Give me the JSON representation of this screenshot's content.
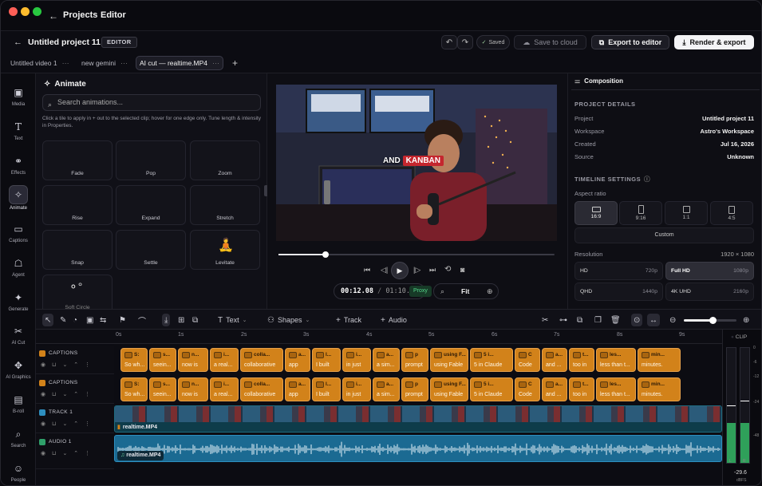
{
  "titlebar": {
    "projects": "Projects",
    "editor": "Editor"
  },
  "header": {
    "project_title": "Untitled project 11",
    "badge": "EDITOR",
    "saved": "Saved",
    "save_cloud": "Save to cloud",
    "export_editor": "Export to editor",
    "render_export": "Render & export"
  },
  "tabs": [
    {
      "label": "Untitled video 1"
    },
    {
      "label": "new gemini"
    },
    {
      "label": "AI cut — realtime.MP4"
    }
  ],
  "rail": [
    {
      "label": "Media",
      "icon": "media-icon"
    },
    {
      "label": "Text",
      "icon": "text-icon"
    },
    {
      "label": "Effects",
      "icon": "effects-icon"
    },
    {
      "label": "Animate",
      "icon": "animate-icon"
    },
    {
      "label": "Captions",
      "icon": "captions-icon"
    },
    {
      "label": "Agent",
      "icon": "agent-icon"
    },
    {
      "label": "Generate",
      "icon": "generate-icon"
    },
    {
      "label": "AI Cut",
      "icon": "scissors-icon"
    },
    {
      "label": "AI Graphics",
      "icon": "ai-graphics-icon"
    },
    {
      "label": "B-roll",
      "icon": "broll-icon"
    },
    {
      "label": "Search",
      "icon": "search-icon"
    },
    {
      "label": "People",
      "icon": "people-icon"
    }
  ],
  "animate": {
    "title": "Animate",
    "search_placeholder": "Search animations...",
    "desc": "Click a tile to apply in + out to the selected clip; hover for one edge only. Tune length & intensity in Properties.",
    "tiles": [
      "Fade",
      "Pop",
      "Zoom",
      "Rise",
      "Expand",
      "Stretch",
      "Snap",
      "Settle",
      "Levitate",
      "Soft Circle"
    ]
  },
  "preview": {
    "caption_a": "AND",
    "caption_b": "KANBAN",
    "time_current": "00:12.08",
    "time_total": "01:10.25",
    "proxy": "Proxy",
    "fit": "Fit",
    "progress": 0.17
  },
  "props": {
    "tab": "Composition",
    "project_details": "PROJECT DETAILS",
    "rows": [
      {
        "k": "Project",
        "v": "Untitled project 11"
      },
      {
        "k": "Workspace",
        "v": "Astro's Workspace"
      },
      {
        "k": "Created",
        "v": "Jul 16, 2026"
      },
      {
        "k": "Source",
        "v": "Unknown"
      }
    ],
    "timeline_settings": "TIMELINE SETTINGS",
    "aspect_label": "Aspect ratio",
    "aspects": [
      "16:9",
      "9:16",
      "1:1",
      "4:5"
    ],
    "custom": "Custom",
    "resolution_label": "Resolution",
    "resolution_value": "1920 × 1080",
    "resolutions": [
      {
        "n": "HD",
        "r": "720p"
      },
      {
        "n": "Full HD",
        "r": "1080p"
      },
      {
        "n": "QHD",
        "r": "1440p"
      },
      {
        "n": "4K UHD",
        "r": "2160p"
      }
    ]
  },
  "toolbar": {
    "text": "Text",
    "shapes": "Shapes",
    "track": "Track",
    "audio": "Audio",
    "zoom": 0.55
  },
  "ruler": [
    "0s",
    "1s",
    "2s",
    "3s",
    "4s",
    "5s",
    "6s",
    "7s",
    "8s",
    "9s"
  ],
  "tracks": [
    {
      "name": "CAPTIONS",
      "color": "#d2821a"
    },
    {
      "name": "CAPTIONS",
      "color": "#d2821a"
    },
    {
      "name": "TRACK 1",
      "color": "#2e8fbf"
    },
    {
      "name": "AUDIO 1",
      "color": "#2fa06a"
    }
  ],
  "captions1": [
    {
      "w": "S:",
      "t": "So wh..."
    },
    {
      "w": "s...",
      "t": "seein..."
    },
    {
      "w": "n...",
      "t": "now is"
    },
    {
      "w": "i...",
      "t": "a real..."
    },
    {
      "w": "colla...",
      "t": "collaborative"
    },
    {
      "w": "a...",
      "t": "app"
    },
    {
      "w": "l...",
      "t": "I built"
    },
    {
      "w": "i...",
      "t": "in just"
    },
    {
      "w": "a...",
      "t": "a sim..."
    },
    {
      "w": "p",
      "t": "prompt"
    },
    {
      "w": "using F...",
      "t": "using Fable"
    },
    {
      "w": "5 i...",
      "t": "5 in Claude"
    },
    {
      "w": "C",
      "t": "Code"
    },
    {
      "w": "a...",
      "t": "and ..."
    },
    {
      "w": "t...",
      "t": "too in"
    },
    {
      "w": "les...",
      "t": "less than t..."
    },
    {
      "w": "min...",
      "t": "minutes."
    }
  ],
  "captions2": [
    {
      "w": "S:",
      "t": "So wh..."
    },
    {
      "w": "s...",
      "t": "seein..."
    },
    {
      "w": "n...",
      "t": "now is"
    },
    {
      "w": "i...",
      "t": "a real..."
    },
    {
      "w": "colla...",
      "t": "collaborative"
    },
    {
      "w": "a...",
      "t": "app"
    },
    {
      "w": "l...",
      "t": "I built"
    },
    {
      "w": "i...",
      "t": "in just"
    },
    {
      "w": "a...",
      "t": "a sim..."
    },
    {
      "w": "p",
      "t": "prompt"
    },
    {
      "w": "using F...",
      "t": "using Fable"
    },
    {
      "w": "5 i...",
      "t": "5 in Claude"
    },
    {
      "w": "C",
      "t": "Code"
    },
    {
      "w": "a...",
      "t": "and ..."
    },
    {
      "w": "t...",
      "t": "too in"
    },
    {
      "w": "les...",
      "t": "less than t..."
    },
    {
      "w": "min...",
      "t": "minutes."
    }
  ],
  "video_clip": "realtime.MP4",
  "audio_clip": "realtime.MP4",
  "meter": {
    "clip": "CLIP",
    "db": "-29.6",
    "unit": "dBFS",
    "l": "L",
    "r": "R",
    "scale": [
      "0",
      "-6",
      "-12",
      "-24",
      "-48"
    ]
  }
}
